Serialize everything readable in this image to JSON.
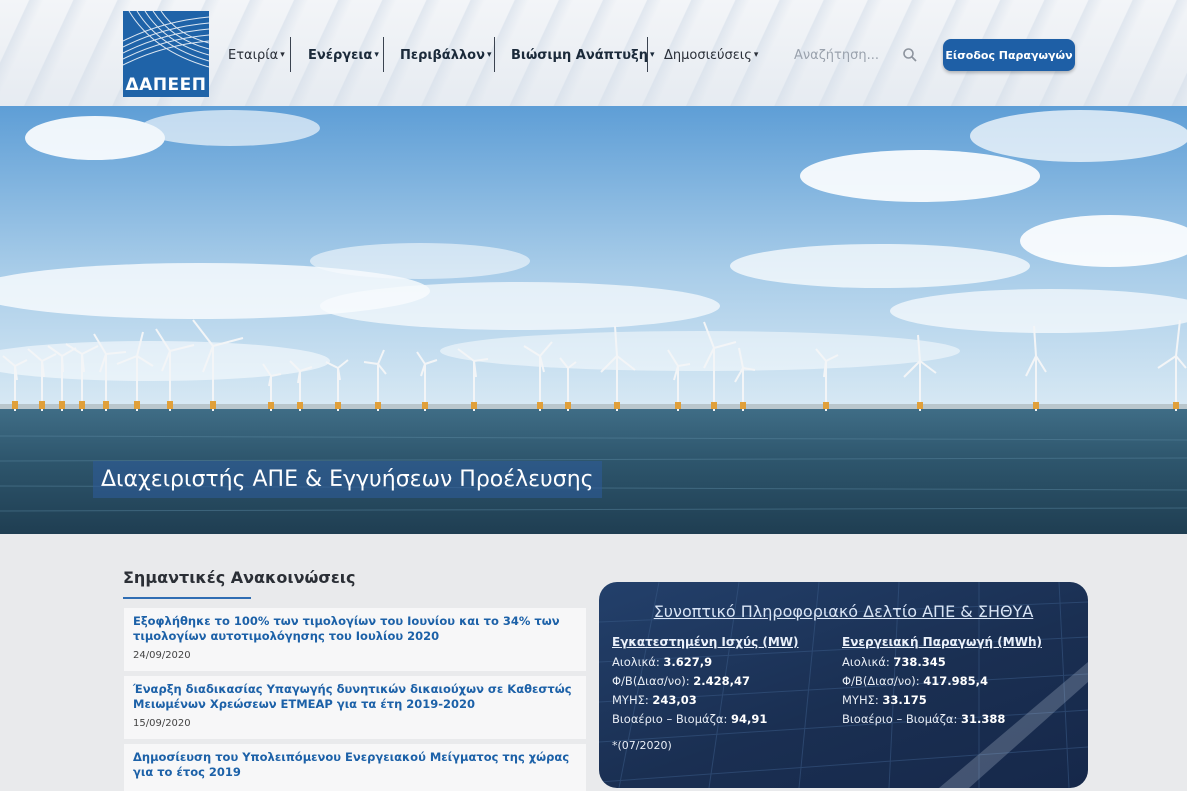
{
  "brand": {
    "logo_text": "ΔΑΠΕΕΠ"
  },
  "nav": [
    {
      "label": "Εταιρία",
      "bold": false
    },
    {
      "label": "Ενέργεια",
      "bold": true
    },
    {
      "label": "Περιβάλλον",
      "bold": true
    },
    {
      "label": "Βιώσιμη Ανάπτυξη",
      "bold": true
    },
    {
      "label": "Δημοσιεύσεις",
      "bold": false
    }
  ],
  "search": {
    "placeholder": "Αναζήτηση..."
  },
  "login_button": "Είσοδος Παραγωγών",
  "hero": {
    "title": "Διαχειριστής ΑΠΕ & Εγγυήσεων Προέλευσης"
  },
  "announcements": {
    "title": "Σημαντικές Ανακοινώσεις",
    "items": [
      {
        "text": "Εξοφλήθηκε το 100% των τιμολογίων του Ιουνίου και το 34% των τιμολογίων αυτοτιμολόγησης του Ιουλίου 2020",
        "date": "24/09/2020"
      },
      {
        "text": "Έναρξη διαδικασίας Υπαγωγής δυνητικών δικαιούχων σε Καθεστώς Μειωμένων Χρεώσεων ΕΤΜΕΑΡ για τα έτη 2019-2020",
        "date": "15/09/2020"
      },
      {
        "text": "Δημοσίευση του Υπολειπόμενου Ενεργειακού Μείγματος της χώρας για το έτος 2019",
        "date": ""
      }
    ]
  },
  "info_panel": {
    "title": "Συνοπτικό Πληροφοριακό Δελτίο ΑΠΕ & ΣΗΘΥΑ",
    "capacity": {
      "heading": "Εγκατεστημένη Ισχύς (MW)",
      "rows": [
        {
          "label": "Αιολικά:",
          "value": "3.627,9"
        },
        {
          "label": "Φ/Β(Διασ/νο):",
          "value": "2.428,47"
        },
        {
          "label": "ΜΥΗΣ:",
          "value": "243,03"
        },
        {
          "label": "Βιοαέριο – Βιομάζα:",
          "value": "94,91"
        }
      ]
    },
    "production": {
      "heading": "Ενεργειακή Παραγωγή (MWh)",
      "rows": [
        {
          "label": "Αιολικά:",
          "value": "738.345"
        },
        {
          "label": "Φ/Β(Διασ/νο):",
          "value": "417.985,4"
        },
        {
          "label": "ΜΥΗΣ:",
          "value": "33.175"
        },
        {
          "label": "Βιοαέριο – Βιομάζα:",
          "value": "31.388"
        }
      ]
    },
    "footnote": "*(07/2020)"
  },
  "colors": {
    "brand_blue": "#1e5fa6",
    "link_blue": "#1c61a8",
    "panel_navy": "#1a2f52"
  }
}
